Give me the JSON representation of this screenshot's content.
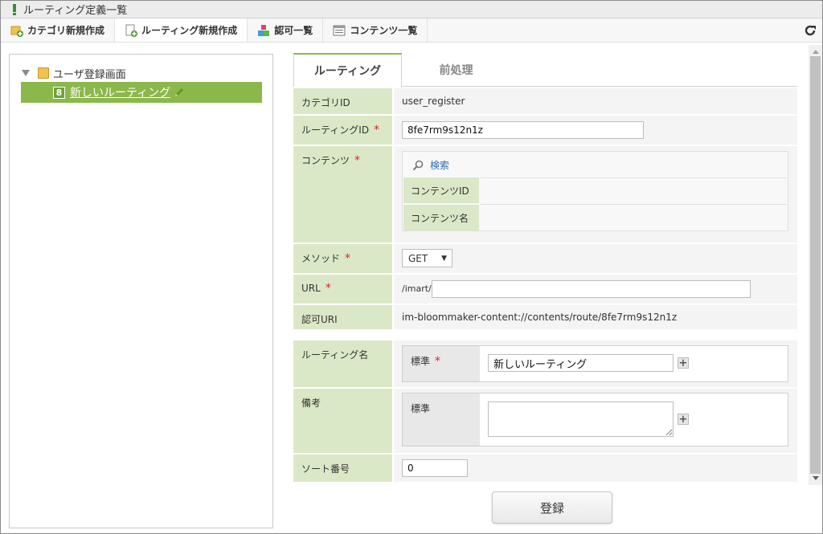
{
  "window": {
    "title": "ルーティング定義一覧"
  },
  "toolbar": {
    "items": [
      {
        "label": "カテゴリ新規作成",
        "icon": "folder-add-icon"
      },
      {
        "label": "ルーティング新規作成",
        "icon": "document-add-icon"
      },
      {
        "label": "認可一覧",
        "icon": "blocks-icon"
      },
      {
        "label": "コンテンツ一覧",
        "icon": "list-window-icon"
      }
    ],
    "refresh_icon": "refresh-icon"
  },
  "tree": {
    "root_label": "ユーザ登録画面",
    "selected_item": {
      "badge": "8",
      "label": "新しいルーティング"
    }
  },
  "tabs": [
    {
      "label": "ルーティング",
      "active": true
    },
    {
      "label": "前処理",
      "active": false
    }
  ],
  "form": {
    "category_id": {
      "label": "カテゴリID",
      "value": "user_register"
    },
    "routing_id": {
      "label": "ルーティングID",
      "required_mark": "*",
      "value": "8fe7rm9s12n1z"
    },
    "contents": {
      "label": "コンテンツ",
      "required_mark": "*",
      "search_label": "検索",
      "content_id_label": "コンテンツID",
      "content_name_label": "コンテンツ名"
    },
    "method": {
      "label": "メソッド",
      "required_mark": "*",
      "value": "GET"
    },
    "url": {
      "label": "URL",
      "required_mark": "*",
      "prefix": "/imart/",
      "value": ""
    },
    "auth_uri": {
      "label": "認可URI",
      "value": "im-bloommaker-content://contents/route/8fe7rm9s12n1z"
    },
    "routing_name": {
      "label": "ルーティング名",
      "locale_label": "標準",
      "required_mark": "*",
      "value": "新しいルーティング"
    },
    "remarks": {
      "label": "備考",
      "locale_label": "標準",
      "value": ""
    },
    "sort_no": {
      "label": "ソート番号",
      "value": "0"
    }
  },
  "submit_label": "登録",
  "colors": {
    "accent_green": "#8bb84a",
    "label_bg": "#dbe8c7",
    "required": "#d9232e"
  }
}
